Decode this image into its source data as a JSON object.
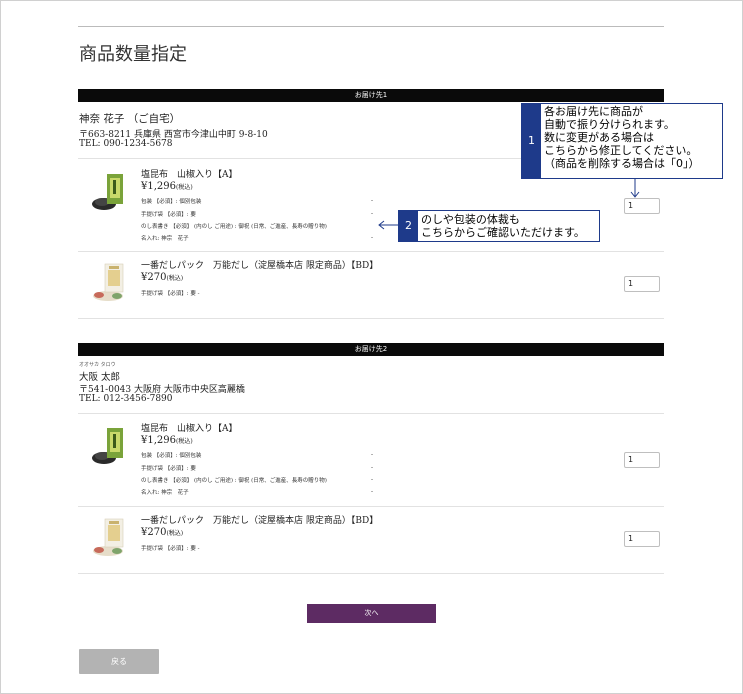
{
  "page": {
    "title": "商品数量指定"
  },
  "sections": [
    {
      "bar_label": "お届け先1",
      "name": "神奈 花子 （ご自宅）",
      "ruby": "",
      "address": "〒663-8211 兵庫県 西宮市今津山中町 9-8-10",
      "tel": "TEL: 090-1234-5678",
      "items": [
        {
          "name": "塩昆布　山椒入り【A】",
          "price": "¥1,296",
          "tax": "(税込)",
          "options": [
            "包装 【必須】: 個別包装",
            "手提げ袋 【必須】: 要",
            "のし表書き 【必須】 (内のし ご用途) : 御祝 (日常、ご進産、長寿の贈り物)",
            "名入れ: 神宗　花子"
          ],
          "qty": "1"
        },
        {
          "name": "一番だしパック　万能だし（淀屋橋本店 限定商品）【BD】",
          "price": "¥270",
          "tax": "(税込)",
          "options": [
            "手提げ袋 【必須】: 要 -"
          ],
          "qty": "1"
        }
      ]
    },
    {
      "bar_label": "お届け先2",
      "name": "大阪 太郎",
      "ruby": "オオサカ タロウ",
      "address": "〒541-0043 大阪府 大阪市中央区高麗橋",
      "tel": "TEL: 012-3456-7890",
      "items": [
        {
          "name": "塩昆布　山椒入り【A】",
          "price": "¥1,296",
          "tax": "(税込)",
          "options": [
            "包装 【必須】: 個別包装",
            "手提げ袋 【必須】: 要",
            "のし表書き 【必須】 (内のし ご用途) : 御祝 (日常、ご進産、長寿の贈り物)",
            "名入れ: 神宗　花子"
          ],
          "qty": "1"
        },
        {
          "name": "一番だしパック　万能だし（淀屋橋本店 限定商品）【BD】",
          "price": "¥270",
          "tax": "(税込)",
          "options": [
            "手提げ袋 【必須】: 要 -"
          ],
          "qty": "1"
        }
      ]
    }
  ],
  "buttons": {
    "next": "次へ",
    "back": "戻る"
  },
  "callouts": [
    {
      "number": "1",
      "lines": [
        "各お届け先に商品が",
        "自動で振り分けられます。",
        "数に変更がある場合は",
        "こちらから修正してください。",
        "（商品を削除する場合は「0」）"
      ]
    },
    {
      "number": "2",
      "lines": [
        "のしや包装の体裁も",
        "こちらからご確認いただけます。"
      ]
    }
  ],
  "colors": {
    "accent": "#5d2b63",
    "callout": "#1e3a8a",
    "bar": "#0a0a0a",
    "back_button": "#b3b3b3"
  }
}
